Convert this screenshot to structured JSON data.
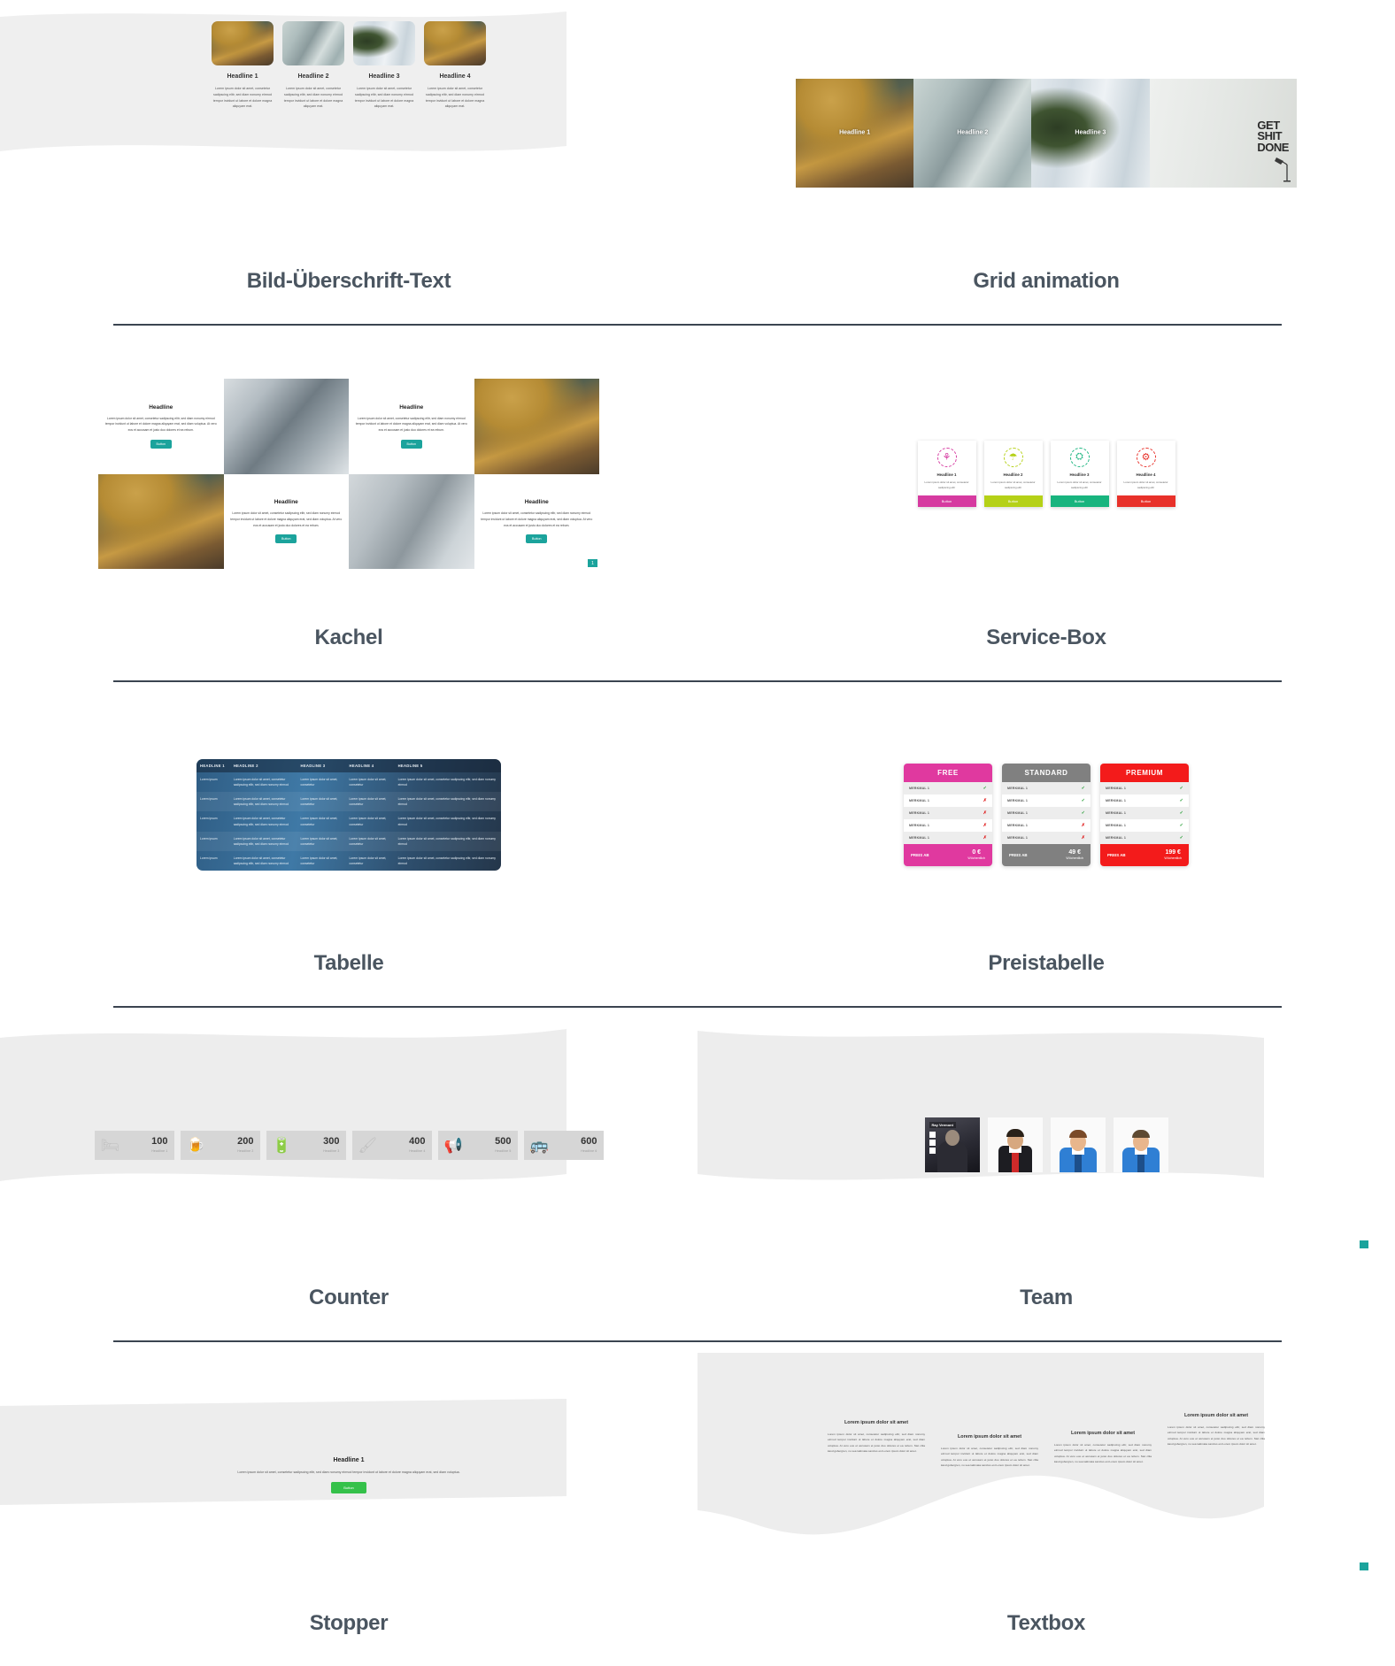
{
  "page": {
    "sections": [
      {
        "id": "bild-ueberschrift-text",
        "caption": "Bild-Überschrift-Text",
        "cards": [
          {
            "headline": "Headline 1",
            "body": "Lorem ipsum dolor sit amet, consetetur sadipscing elitr, sed diam nonumy eirmod tempor invidunt ut labore et dolore magna aliquyam erat."
          },
          {
            "headline": "Headline 2",
            "body": "Lorem ipsum dolor sit amet, consetetur sadipscing elitr, sed diam nonumy eirmod tempor invidunt ut labore et dolore magna aliquyam erat."
          },
          {
            "headline": "Headline 3",
            "body": "Lorem ipsum dolor sit amet, consetetur sadipscing elitr, sed diam nonumy eirmod tempor invidunt ut labore et dolore magna aliquyam erat."
          },
          {
            "headline": "Headline 4",
            "body": "Lorem ipsum dolor sit amet, consetetur sadipscing elitr, sed diam nonumy eirmod tempor invidunt ut labore et dolore magna aliquyam erat."
          }
        ]
      },
      {
        "id": "grid-animation",
        "caption": "Grid animation",
        "tiles": [
          {
            "label": "Headline 1"
          },
          {
            "label": "Headline 2"
          },
          {
            "label": "Headline 3"
          },
          {
            "label": ""
          }
        ],
        "poster": {
          "line1": "GET",
          "line2": "SHIT",
          "line3": "DONE"
        }
      },
      {
        "id": "kachel",
        "caption": "Kachel",
        "tiles": [
          {
            "headline": "Headline",
            "body": "Lorem ipsum dolor sit amet, consetetur sadipscing elitr, sed diam nonumy eirmod tempor invidunt ut labore et dolore magna aliquyam erat, sed diam voluptua. At vero eos et accusam et justo duo dolores et ea rebum.",
            "button": "Button"
          },
          {
            "headline": "Headline",
            "body": "Lorem ipsum dolor sit amet, consetetur sadipscing elitr, sed diam nonumy eirmod tempor invidunt ut labore et dolore magna aliquyam erat, sed diam voluptua. At vero eos et accusam et justo duo dolores et ea rebum.",
            "button": "Button"
          },
          {
            "headline": "Headline",
            "body": "Lorem ipsum dolor sit amet, consetetur sadipscing elitr, sed diam nonumy eirmod tempor invidunt ut labore et dolore magna aliquyam erat, sed diam voluptua. At vero eos et accusam et justo duo dolores et ea rebum.",
            "button": "Button"
          },
          {
            "headline": "Headline",
            "body": "Lorem ipsum dolor sit amet, consetetur sadipscing elitr, sed diam nonumy eirmod tempor invidunt ut labore et dolore magna aliquyam erat, sed diam voluptua. At vero eos et accusam et justo duo dolores et ea rebum.",
            "button": "Button"
          }
        ],
        "badge": "1"
      },
      {
        "id": "service-box",
        "caption": "Service-Box",
        "boxes": [
          {
            "headline": "Headline 1",
            "body": "Lorem ipsum dolor sit amet, consetetur sadipscing elitr",
            "button": "Button",
            "color": "#d63aa0",
            "icon": "bicycle-icon",
            "glyph": "⚘"
          },
          {
            "headline": "Headline 2",
            "body": "Lorem ipsum dolor sit amet, consetetur sadipscing elitr",
            "button": "Button",
            "color": "#b5d117",
            "icon": "rocket-icon",
            "glyph": "☂"
          },
          {
            "headline": "Headline 3",
            "body": "Lorem ipsum dolor sit amet, consetetur sadipscing elitr",
            "button": "Button",
            "color": "#18b47e",
            "icon": "car-icon",
            "glyph": "⛭"
          },
          {
            "headline": "Headline 4",
            "body": "Lorem ipsum dolor sit amet, consetetur sadipscing elitr",
            "button": "Button",
            "color": "#e8312a",
            "icon": "gears-icon",
            "glyph": "⚙"
          }
        ]
      },
      {
        "id": "tabelle",
        "caption": "Tabelle",
        "columns": [
          "HEADLINE 1",
          "HEADLINE 2",
          "HEADLINE 3",
          "HEADLINE 4",
          "HEADLINE 5"
        ],
        "rows": [
          [
            "Lorem ipsum",
            "Lorem ipsum dolor sit amet, consetetur sadipscing elitr, sed diam nonumy eirmod",
            "Lorem ipsum dolor sit amet, consetetur",
            "Lorem ipsum dolor sit amet, consetetur",
            "Lorem ipsum dolor sit amet, consetetur sadipscing elitr, sed diam nonumy eirmod"
          ],
          [
            "Lorem ipsum",
            "Lorem ipsum dolor sit amet, consetetur sadipscing elitr, sed diam nonumy eirmod",
            "Lorem ipsum dolor sit amet, consetetur",
            "Lorem ipsum dolor sit amet, consetetur",
            "Lorem ipsum dolor sit amet, consetetur sadipscing elitr, sed diam nonumy eirmod"
          ],
          [
            "Lorem ipsum",
            "Lorem ipsum dolor sit amet, consetetur sadipscing elitr, sed diam nonumy eirmod",
            "Lorem ipsum dolor sit amet, consetetur",
            "Lorem ipsum dolor sit amet, consetetur",
            "Lorem ipsum dolor sit amet, consetetur sadipscing elitr, sed diam nonumy eirmod"
          ],
          [
            "Lorem ipsum",
            "Lorem ipsum dolor sit amet, consetetur sadipscing elitr, sed diam nonumy eirmod",
            "Lorem ipsum dolor sit amet, consetetur",
            "Lorem ipsum dolor sit amet, consetetur",
            "Lorem ipsum dolor sit amet, consetetur sadipscing elitr, sed diam nonumy eirmod"
          ],
          [
            "Lorem ipsum",
            "Lorem ipsum dolor sit amet, consetetur sadipscing elitr, sed diam nonumy eirmod",
            "Lorem ipsum dolor sit amet, consetetur",
            "Lorem ipsum dolor sit amet, consetetur",
            "Lorem ipsum dolor sit amet, consetetur sadipscing elitr, sed diam nonumy eirmod"
          ]
        ]
      },
      {
        "id": "preistabelle",
        "caption": "Preistabelle",
        "price_label": "PREIS AB",
        "period": "Wöchentlich",
        "plans": [
          {
            "name": "FREE",
            "color": "#e0399f",
            "price": "0 €",
            "features": [
              {
                "label": "MERKMAL 1",
                "included": true
              },
              {
                "label": "MERKMAL 1",
                "included": false
              },
              {
                "label": "MERKMAL 1",
                "included": false
              },
              {
                "label": "MERKMAL 1",
                "included": false
              },
              {
                "label": "MERKMAL 1",
                "included": false
              }
            ]
          },
          {
            "name": "STANDARD",
            "color": "#808080",
            "price": "49 €",
            "features": [
              {
                "label": "MERKMAL 1",
                "included": true
              },
              {
                "label": "MERKMAL 1",
                "included": true
              },
              {
                "label": "MERKMAL 1",
                "included": true
              },
              {
                "label": "MERKMAL 1",
                "included": false
              },
              {
                "label": "MERKMAL 1",
                "included": false
              }
            ]
          },
          {
            "name": "PREMIUM",
            "color": "#f31b1b",
            "price": "199 €",
            "features": [
              {
                "label": "MERKMAL 1",
                "included": true
              },
              {
                "label": "MERKMAL 1",
                "included": true
              },
              {
                "label": "MERKMAL 1",
                "included": true
              },
              {
                "label": "MERKMAL 1",
                "included": true
              },
              {
                "label": "MERKMAL 1",
                "included": true
              }
            ]
          }
        ]
      },
      {
        "id": "counter",
        "caption": "Counter",
        "items": [
          {
            "value": "100",
            "label": "Headline 1",
            "icon": "bed-icon",
            "glyph": "🛏"
          },
          {
            "value": "200",
            "label": "Headline 2",
            "icon": "beer-mug-icon",
            "glyph": "🍺"
          },
          {
            "value": "300",
            "label": "Headline 3",
            "icon": "battery-icon",
            "glyph": "🔋"
          },
          {
            "value": "400",
            "label": "Headline 4",
            "icon": "paint-roller-icon",
            "glyph": "🖌"
          },
          {
            "value": "500",
            "label": "Headline 5",
            "icon": "megaphone-icon",
            "glyph": "📢"
          },
          {
            "value": "600",
            "label": "Headline 6",
            "icon": "bus-icon",
            "glyph": "🚌"
          }
        ]
      },
      {
        "id": "team",
        "caption": "Team",
        "members": [
          {
            "name": "Ray Vermont",
            "social": [
              "facebook-icon",
              "twitter-icon",
              "linkedin-icon"
            ]
          },
          {
            "name": "",
            "social": []
          },
          {
            "name": "",
            "social": []
          },
          {
            "name": "",
            "social": []
          }
        ]
      },
      {
        "id": "stopper",
        "caption": "Stopper",
        "headline": "Headline 1",
        "body": "Lorem ipsum dolor sit amet, consetetur sadipscing elitr, sed diam nonumy eirmod tempor invidunt ut labore et dolore magna aliquyam erat, sed diam voluptua.",
        "button": "Button"
      },
      {
        "id": "textbox",
        "caption": "Textbox",
        "columns": [
          {
            "headline": "Lorem ipsum dolor sit amet",
            "body": "Lorem ipsum dolor sit amet, consetetur sadipscing elitr, sed diam nonumy eirmod tempor invidunt ut labore et dolore magna aliquyam erat, sed diam voluptua. At vero eos et accusam et justo duo dolores et ea rebum. Stet clita kasd gubergren, no sea takimata sanctus est Lorem ipsum dolor sit amet."
          },
          {
            "headline": "Lorem ipsum dolor sit amet",
            "body": "Lorem ipsum dolor sit amet, consetetur sadipscing elitr, sed diam nonumy eirmod tempor invidunt ut labore et dolore magna aliquyam erat, sed diam voluptua. At vero eos et accusam et justo duo dolores et ea rebum. Stet clita kasd gubergren, no sea takimata sanctus est Lorem ipsum dolor sit amet."
          },
          {
            "headline": "Lorem ipsum dolor sit amet",
            "body": "Lorem ipsum dolor sit amet, consetetur sadipscing elitr, sed diam nonumy eirmod tempor invidunt ut labore et dolore magna aliquyam erat, sed diam voluptua. At vero eos et accusam et justo duo dolores et ea rebum. Stet clita kasd gubergren, no sea takimata sanctus est Lorem ipsum dolor sit amet."
          },
          {
            "headline": "Lorem ipsum dolor sit amet",
            "body": "Lorem ipsum dolor sit amet, consetetur sadipscing elitr, sed diam nonumy eirmod tempor invidunt ut labore et dolore magna aliquyam erat, sed diam voluptua. At vero eos et accusam et justo duo dolores et ea rebum. Stet clita kasd gubergren, no sea takimata sanctus est Lorem ipsum dolor sit amet."
          }
        ]
      }
    ]
  }
}
